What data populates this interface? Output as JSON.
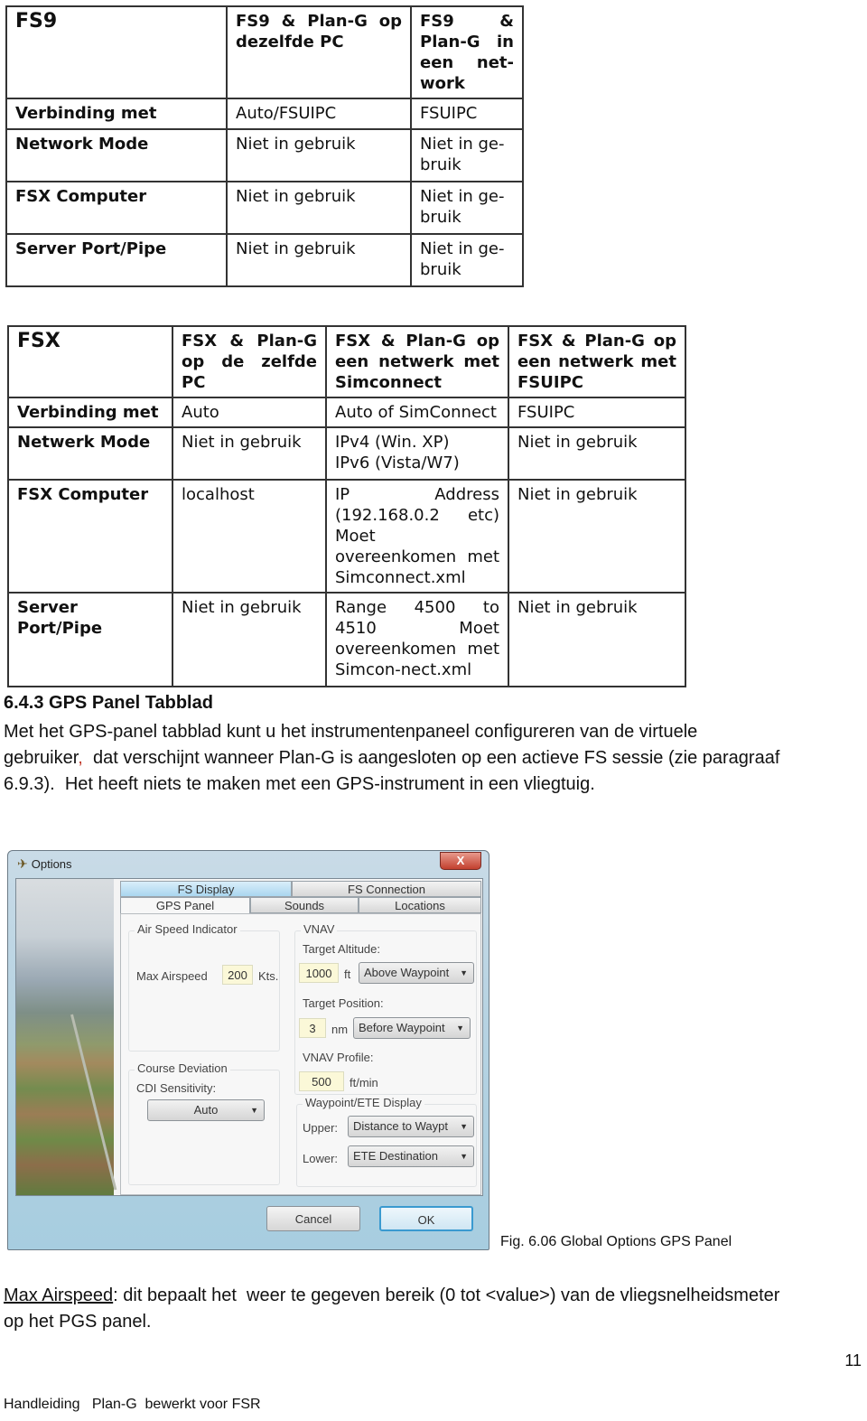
{
  "table_fs9": {
    "header": [
      "FS9",
      "FS9 & Plan-G op dezelfde PC",
      "FS9 & Plan-G in een net-work"
    ],
    "rows": [
      {
        "label": "Verbinding met",
        "c1": "Auto/FSUIPC",
        "c2": "FSUIPC"
      },
      {
        "label": "Network Mode",
        "c1": "Niet in gebruik",
        "c2": "Niet in ge-bruik"
      },
      {
        "label": "FSX Computer",
        "c1": "Niet in gebruik",
        "c2": "Niet in ge-bruik"
      },
      {
        "label": "Server Port/Pipe",
        "c1": "Niet in gebruik",
        "c2": "Niet in ge-bruik"
      }
    ]
  },
  "table_fsx": {
    "header": [
      "FSX",
      "FSX & Plan-G op de zelfde PC",
      "FSX & Plan-G op een netwerk met Simconnect",
      "FSX & Plan-G op een netwerk met FSUIPC"
    ],
    "rows": [
      {
        "label": "Verbinding met",
        "c1": "Auto",
        "c2": "Auto of SimConnect",
        "c3": "FSUIPC"
      },
      {
        "label": "Netwerk Mode",
        "c1": "Niet in gebruik",
        "c2a": "IPv4 (Win. XP)",
        "c2b": "IPv6 (Vista/W7)",
        "c3": "Niet in gebruik"
      },
      {
        "label": "FSX Computer",
        "c1": "localhost",
        "c2": "IP Address (192.168.0.2 etc) Moet overeenkomen met Simconnect.xml",
        "c3": "Niet in gebruik"
      },
      {
        "label": "Server Port/Pipe",
        "c1": "Niet in gebruik",
        "c2": "Range 4500 to 4510 Moet overeenkomen met Simcon-nect.xml",
        "c3": "Niet in gebruik"
      }
    ]
  },
  "section": {
    "heading": "6.4.3 GPS Panel Tabblad",
    "p1_line1": "Met het GPS-panel tabblad kunt u het instrumentenpaneel configureren van de virtuele",
    "p1_line2a": "gebruiker",
    "p1_comma": ",",
    "p1_line2b": "  dat verschijnt wanneer Plan-G is aangesloten op een actieve FS sessie (zie paragraaf",
    "p1_line3": "6.9.3).  Het heeft niets te maken met een GPS-instrument in een vliegtuig."
  },
  "dialog": {
    "title": "Options",
    "close_label": "X",
    "tabs_row1": [
      "FS Display",
      "FS Connection"
    ],
    "tabs_row2": [
      "GPS Panel",
      "Sounds",
      "Locations"
    ],
    "active_tab": "GPS Panel",
    "air_speed": {
      "group": "Air Speed Indicator",
      "label": "Max Airspeed",
      "value": "200",
      "unit": "Kts."
    },
    "course_deviation": {
      "group": "Course Deviation",
      "label": "CDI Sensitivity:",
      "value": "Auto"
    },
    "vnav": {
      "group": "VNAV",
      "target_altitude_label": "Target Altitude:",
      "target_altitude_value": "1000",
      "target_altitude_unit": "ft",
      "target_altitude_ref": "Above Waypoint",
      "target_position_label": "Target Position:",
      "target_position_value": "3",
      "target_position_unit": "nm",
      "target_position_ref": "Before Waypoint",
      "profile_label": "VNAV Profile:",
      "profile_value": "500",
      "profile_unit": "ft/min"
    },
    "waypoint_display": {
      "group": "Waypoint/ETE Display",
      "upper_label": "Upper:",
      "upper_value": "Distance to Waypt",
      "lower_label": "Lower:",
      "lower_value": "ETE Destination"
    },
    "cancel_label": "Cancel",
    "ok_label": "OK"
  },
  "caption": "Fig. 6.06 Global Options GPS Panel",
  "para2": {
    "term": "Max Airspeed",
    "line1_rest": ": dit bepaalt het  weer te gegeven bereik (0 tot <value>) van de vliegsnelheidsmeter",
    "line2": "op het PGS panel."
  },
  "page_number": "11",
  "footer": "Handleiding   Plan-G  bewerkt voor FSR"
}
